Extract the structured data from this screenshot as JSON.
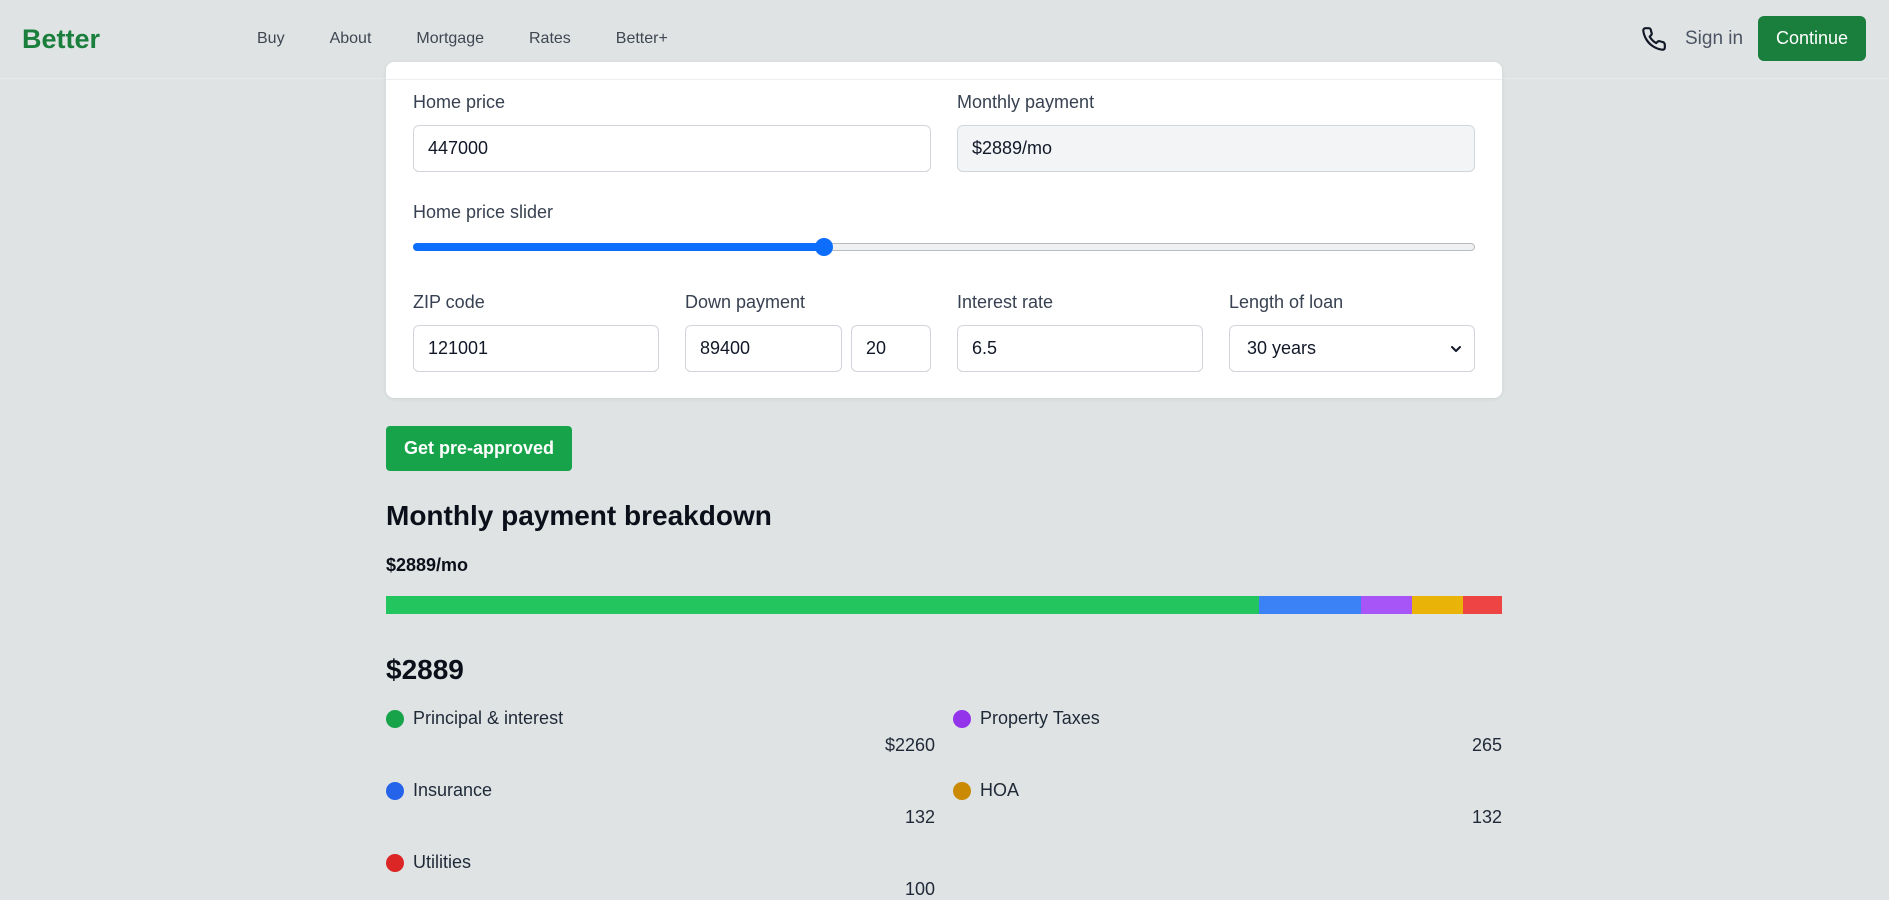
{
  "header": {
    "brand": "Better",
    "nav": [
      "Buy",
      "About",
      "Mortgage",
      "Rates",
      "Better+"
    ],
    "phone_icon": "phone-icon",
    "signin": "Sign in",
    "continue": "Continue"
  },
  "calculator": {
    "home_price_label": "Home price",
    "home_price_value": "447000",
    "monthly_payment_label": "Monthly payment",
    "monthly_payment_value": "$2889/mo",
    "slider_label": "Home price slider",
    "slider_fraction": 0.387,
    "zip_label": "ZIP code",
    "zip_value": "121001",
    "down_label": "Down payment",
    "down_amount": "89400",
    "down_percent": "20",
    "rate_label": "Interest rate",
    "rate_value": "6.5",
    "loan_label": "Length of loan",
    "loan_value": "30 years"
  },
  "preapproved_button": "Get pre-approved",
  "breakdown": {
    "title": "Monthly payment breakdown",
    "subtitle": "$2889/mo",
    "total": "$2889",
    "bar_segments": [
      {
        "value": 2260,
        "color": "#22c55e"
      },
      {
        "value": 265,
        "color": "#3b82f6"
      },
      {
        "value": 132,
        "color": "#a855f7"
      },
      {
        "value": 132,
        "color": "#eab308"
      },
      {
        "value": 100,
        "color": "#ef4444"
      }
    ],
    "items": [
      {
        "label": "Principal & interest",
        "value": "$2260",
        "color": "#16a34a"
      },
      {
        "label": "Property Taxes",
        "value": "265",
        "color": "#9333ea"
      },
      {
        "label": "Insurance",
        "value": "132",
        "color": "#2563eb"
      },
      {
        "label": "HOA",
        "value": "132",
        "color": "#ca8a04"
      },
      {
        "label": "Utilities",
        "value": "100",
        "color": "#dc2626"
      }
    ]
  }
}
